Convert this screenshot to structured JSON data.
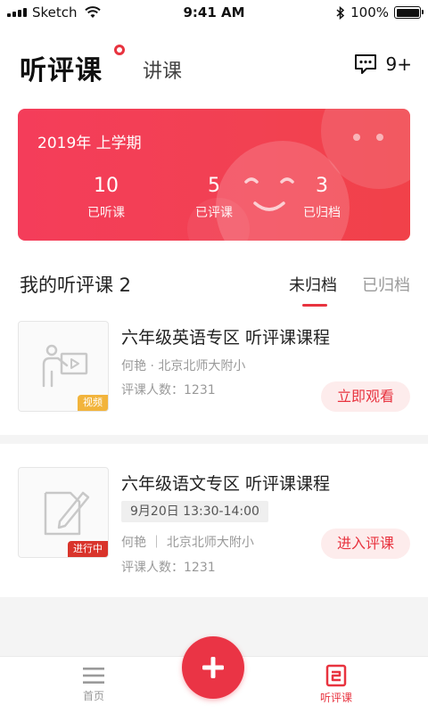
{
  "status_bar": {
    "carrier": "Sketch",
    "time": "9:41 AM",
    "battery": "100%"
  },
  "header": {
    "tab_active": "听评课",
    "tab_secondary": "讲课",
    "message_count": "9+"
  },
  "banner": {
    "semester": "2019年 上学期",
    "stats": [
      {
        "value": "10",
        "label": "已听课"
      },
      {
        "value": "5",
        "label": "已评课"
      },
      {
        "value": "3",
        "label": "已归档"
      }
    ]
  },
  "list": {
    "title": "我的听评课 2",
    "filters": [
      "未归档",
      "已归档"
    ]
  },
  "courses": [
    {
      "title": "六年级英语专区 听评课课程",
      "teacher_school": "何艳 · 北京北师大附小",
      "reviewers": "评课人数：1231",
      "badge": "视频",
      "action": "立即观看"
    },
    {
      "title": "六年级语文专区 听评课课程",
      "time": "9月20日 13:30-14:00",
      "teacher_school": "何艳 ｜ 北京北师大附小",
      "reviewers": "评课人数：1231",
      "badge": "进行中",
      "action": "进入评课"
    }
  ],
  "tabbar": {
    "home_label": "首页",
    "review_label": "听评课"
  },
  "colors": {
    "accent": "#e8333f",
    "banner_start": "#f43d5a",
    "badge_video": "#f2b43c",
    "badge_live": "#d9342b"
  },
  "icons": [
    "message-icon",
    "teacher-board-icon",
    "edit-document-icon",
    "menu-icon",
    "plus-icon",
    "review-tab-icon",
    "signal-icon",
    "wifi-icon",
    "bluetooth-icon",
    "battery-icon"
  ]
}
